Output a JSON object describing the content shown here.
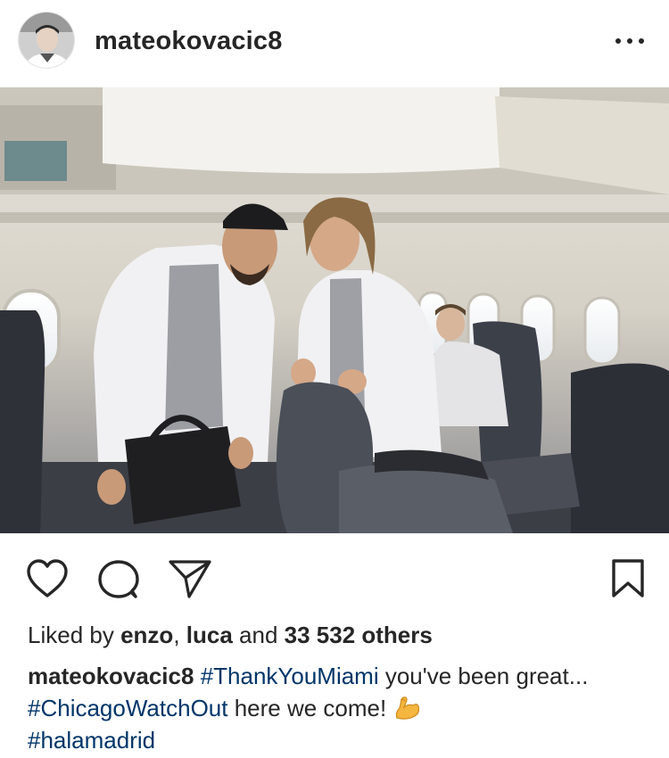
{
  "post": {
    "username": "mateokovacic8",
    "more_icon": "ellipsis-icon",
    "likes": {
      "prefix": "Liked by ",
      "user1": "enzo",
      "sep": ", ",
      "user2": "luca",
      "and": " and ",
      "others": "33 532 others"
    },
    "caption": {
      "username": "mateokovacic8",
      "hashtag1": "#ThankYouMiami",
      "text1": " you've been great... ",
      "hashtag2": "#ChicagoWatchOut",
      "text2": " here we come! ",
      "emoji_icon": "flexed-biceps-icon",
      "hashtag3": "#halamadrid"
    }
  },
  "actions": {
    "like_icon": "heart-icon",
    "comment_icon": "comment-icon",
    "share_icon": "send-icon",
    "save_icon": "bookmark-icon"
  },
  "colors": {
    "text": "#262626",
    "hashtag": "#003569",
    "emoji": "#f4b63f"
  }
}
